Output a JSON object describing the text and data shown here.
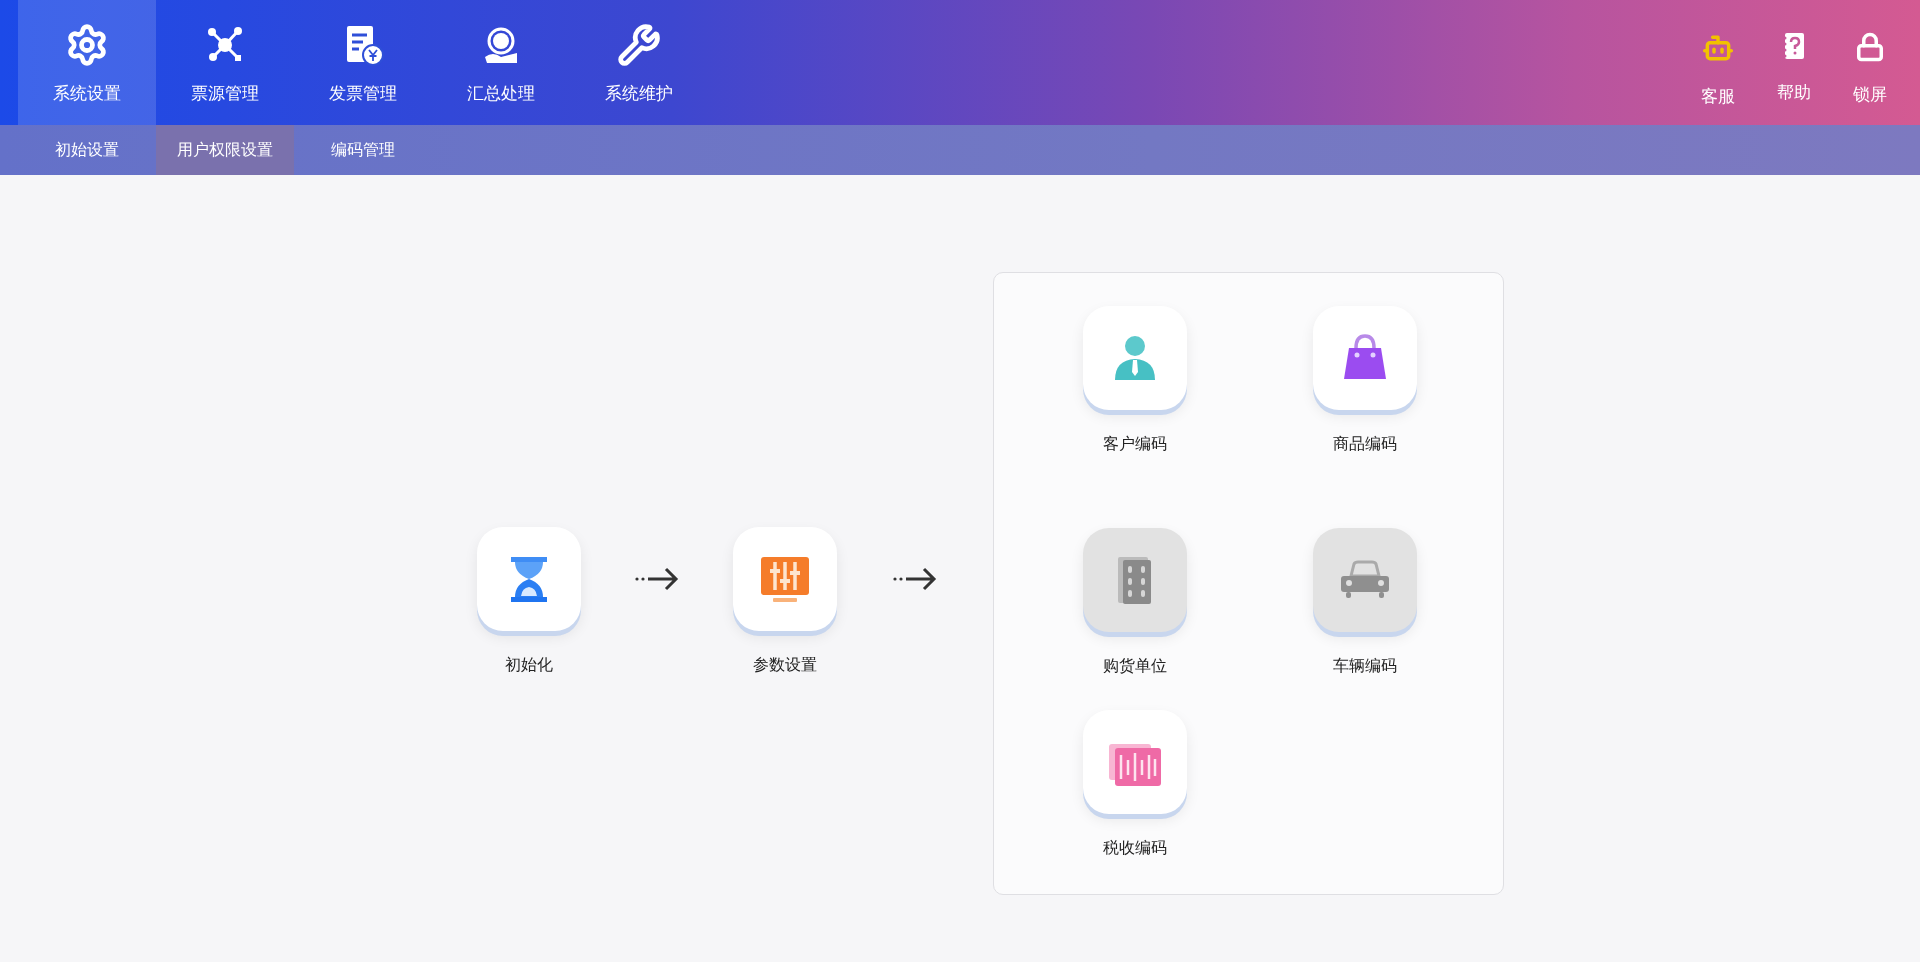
{
  "nav": [
    {
      "label": "系统设置",
      "kind": "gear",
      "selected": true
    },
    {
      "label": "票源管理",
      "kind": "network",
      "selected": false
    },
    {
      "label": "发票管理",
      "kind": "invoice",
      "selected": false
    },
    {
      "label": "汇总处理",
      "kind": "tax",
      "selected": false
    },
    {
      "label": "系统维护",
      "kind": "wrench",
      "selected": false
    }
  ],
  "tools": [
    {
      "label": "客服",
      "kind": "robot"
    },
    {
      "label": "帮助",
      "kind": "help"
    },
    {
      "label": "锁屏",
      "kind": "lock"
    }
  ],
  "subnav": [
    {
      "label": "初始设置",
      "selected": false
    },
    {
      "label": "用户权限设置",
      "selected": true
    },
    {
      "label": "编码管理",
      "selected": false
    }
  ],
  "flow": [
    {
      "label": "初始化",
      "kind": "hourglass"
    },
    {
      "label": "参数设置",
      "kind": "sliders"
    }
  ],
  "codes": [
    {
      "label": "客户编码",
      "kind": "person",
      "disabled": false
    },
    {
      "label": "商品编码",
      "kind": "bag",
      "disabled": false
    },
    {
      "label": "购货单位",
      "kind": "building",
      "disabled": true
    },
    {
      "label": "车辆编码",
      "kind": "car",
      "disabled": true
    },
    {
      "label": "税收编码",
      "kind": "barcode",
      "disabled": false
    }
  ]
}
